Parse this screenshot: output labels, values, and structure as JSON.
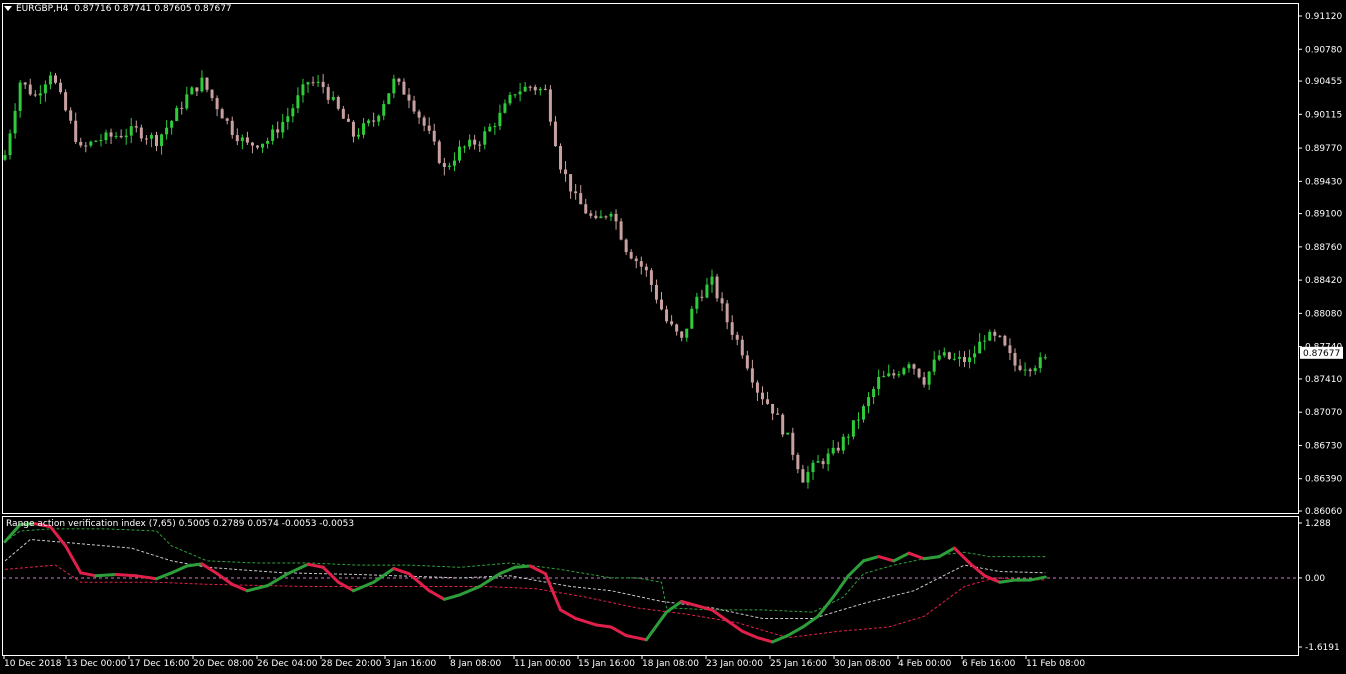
{
  "header": {
    "symbol": "EURGBP,H4",
    "ohlc": "0.87716 0.87741 0.87605 0.87677"
  },
  "indicator": {
    "title": "Range action verification index (7,65) 0.5005 0.2789 0.0574 -0.0053 -0.0053"
  },
  "colors": {
    "background": "#000000",
    "frame": "#ffffff",
    "bull_candle": "#2ecc3a",
    "bear_candle": "#c8a0a0",
    "line_up": "#2e9e3a",
    "line_down": "#e0204a",
    "zero_line": "#c878c8",
    "band_upper": "#2e9e3a",
    "band_lower": "#e0204a",
    "band_mid": "#c8c8c8"
  },
  "chart_data": [
    {
      "type": "candlestick",
      "symbol": "EURGBP",
      "timeframe": "H4",
      "current_price": "0.87677",
      "y_ticks": [
        "0.91120",
        "0.90780",
        "0.90455",
        "0.90115",
        "0.89770",
        "0.89430",
        "0.89100",
        "0.88760",
        "0.88420",
        "0.88080",
        "0.87740",
        "0.87410",
        "0.87070",
        "0.86730",
        "0.86390",
        "0.86060"
      ],
      "ylim": [
        0.8606,
        0.9112
      ],
      "x_ticks": [
        "10 Dec 2018",
        "13 Dec 00:00",
        "17 Dec 16:00",
        "20 Dec 08:00",
        "26 Dec 04:00",
        "28 Dec 20:00",
        "3 Jan 16:00",
        "8 Jan 08:00",
        "11 Jan 00:00",
        "15 Jan 16:00",
        "18 Jan 08:00",
        "23 Jan 00:00",
        "25 Jan 16:00",
        "30 Jan 08:00",
        "4 Feb 00:00",
        "6 Feb 16:00",
        "11 Feb 08:00"
      ],
      "close_path": [
        [
          0,
          0.897
        ],
        [
          3,
          0.9045
        ],
        [
          6,
          0.903
        ],
        [
          9,
          0.9055
        ],
        [
          12,
          0.9015
        ],
        [
          15,
          0.8975
        ],
        [
          18,
          0.8985
        ],
        [
          22,
          0.899
        ],
        [
          26,
          0.8995
        ],
        [
          30,
          0.8985
        ],
        [
          33,
          0.9005
        ],
        [
          36,
          0.903
        ],
        [
          39,
          0.9045
        ],
        [
          42,
          0.902
        ],
        [
          45,
          0.8995
        ],
        [
          48,
          0.898
        ],
        [
          52,
          0.8985
        ],
        [
          56,
          0.901
        ],
        [
          60,
          0.9045
        ],
        [
          63,
          0.904
        ],
        [
          66,
          0.9015
        ],
        [
          69,
          0.899
        ],
        [
          73,
          0.9005
        ],
        [
          77,
          0.9045
        ],
        [
          80,
          0.903
        ],
        [
          84,
          0.899
        ],
        [
          87,
          0.8955
        ],
        [
          90,
          0.8975
        ],
        [
          94,
          0.8985
        ],
        [
          98,
          0.901
        ],
        [
          101,
          0.9035
        ],
        [
          104,
          0.904
        ],
        [
          107,
          0.9035
        ],
        [
          110,
          0.896
        ],
        [
          113,
          0.8925
        ],
        [
          117,
          0.89
        ],
        [
          120,
          0.8915
        ],
        [
          123,
          0.8875
        ],
        [
          127,
          0.885
        ],
        [
          131,
          0.88
        ],
        [
          134,
          0.878
        ],
        [
          137,
          0.8825
        ],
        [
          140,
          0.884
        ],
        [
          143,
          0.88
        ],
        [
          146,
          0.877
        ],
        [
          149,
          0.873
        ],
        [
          152,
          0.871
        ],
        [
          155,
          0.868
        ],
        [
          158,
          0.864
        ],
        [
          161,
          0.8655
        ],
        [
          164,
          0.8665
        ],
        [
          167,
          0.8685
        ],
        [
          170,
          0.871
        ],
        [
          173,
          0.874
        ],
        [
          176,
          0.8745
        ],
        [
          179,
          0.876
        ],
        [
          182,
          0.874
        ],
        [
          185,
          0.8765
        ],
        [
          188,
          0.876
        ],
        [
          191,
          0.876
        ],
        [
          194,
          0.8785
        ],
        [
          197,
          0.878
        ],
        [
          200,
          0.8755
        ],
        [
          203,
          0.8755
        ],
        [
          206,
          0.876
        ]
      ]
    },
    {
      "type": "line",
      "title": "Range action verification index (7,65)",
      "values_in_title": [
        0.5005,
        0.2789,
        0.0574,
        -0.0053,
        -0.0053
      ],
      "y_ticks": [
        "1.288",
        "0.00",
        "-1.6191"
      ],
      "ylim": [
        -1.6191,
        1.288
      ],
      "main_line": [
        [
          0,
          0.85
        ],
        [
          3,
          1.25
        ],
        [
          6,
          1.27
        ],
        [
          9,
          1.2
        ],
        [
          12,
          0.75
        ],
        [
          15,
          0.12
        ],
        [
          18,
          0.05
        ],
        [
          22,
          0.08
        ],
        [
          26,
          0.05
        ],
        [
          30,
          -0.02
        ],
        [
          33,
          0.12
        ],
        [
          36,
          0.28
        ],
        [
          39,
          0.33
        ],
        [
          42,
          0.1
        ],
        [
          45,
          -0.15
        ],
        [
          48,
          -0.3
        ],
        [
          52,
          -0.18
        ],
        [
          56,
          0.1
        ],
        [
          60,
          0.32
        ],
        [
          63,
          0.25
        ],
        [
          66,
          -0.1
        ],
        [
          69,
          -0.3
        ],
        [
          73,
          -0.1
        ],
        [
          77,
          0.22
        ],
        [
          80,
          0.1
        ],
        [
          84,
          -0.3
        ],
        [
          87,
          -0.5
        ],
        [
          90,
          -0.4
        ],
        [
          94,
          -0.2
        ],
        [
          98,
          0.1
        ],
        [
          101,
          0.25
        ],
        [
          104,
          0.28
        ],
        [
          107,
          0.1
        ],
        [
          110,
          -0.75
        ],
        [
          113,
          -0.95
        ],
        [
          117,
          -1.1
        ],
        [
          120,
          -1.15
        ],
        [
          123,
          -1.35
        ],
        [
          127,
          -1.45
        ],
        [
          131,
          -0.8
        ],
        [
          134,
          -0.55
        ],
        [
          137,
          -0.65
        ],
        [
          140,
          -0.75
        ],
        [
          143,
          -1.0
        ],
        [
          146,
          -1.25
        ],
        [
          149,
          -1.4
        ],
        [
          152,
          -1.5
        ],
        [
          155,
          -1.35
        ],
        [
          158,
          -1.15
        ],
        [
          161,
          -0.9
        ],
        [
          164,
          -0.45
        ],
        [
          167,
          0.05
        ],
        [
          170,
          0.4
        ],
        [
          173,
          0.5
        ],
        [
          176,
          0.4
        ],
        [
          179,
          0.58
        ],
        [
          182,
          0.45
        ],
        [
          185,
          0.5
        ],
        [
          188,
          0.7
        ],
        [
          191,
          0.35
        ],
        [
          194,
          0.05
        ],
        [
          197,
          -0.1
        ],
        [
          200,
          -0.05
        ],
        [
          203,
          -0.05
        ],
        [
          206,
          0.02
        ]
      ],
      "upper_band": [
        [
          0,
          0.85
        ],
        [
          3,
          1.1
        ],
        [
          9,
          1.15
        ],
        [
          20,
          1.15
        ],
        [
          30,
          1.1
        ],
        [
          33,
          0.75
        ],
        [
          40,
          0.4
        ],
        [
          50,
          0.35
        ],
        [
          60,
          0.35
        ],
        [
          70,
          0.3
        ],
        [
          80,
          0.3
        ],
        [
          90,
          0.25
        ],
        [
          100,
          0.35
        ],
        [
          110,
          0.2
        ],
        [
          120,
          0.0
        ],
        [
          125,
          0.0
        ],
        [
          130,
          -0.1
        ],
        [
          131,
          -0.7
        ],
        [
          140,
          -0.75
        ],
        [
          150,
          -0.75
        ],
        [
          160,
          -0.8
        ],
        [
          166,
          -0.45
        ],
        [
          170,
          0.1
        ],
        [
          176,
          0.3
        ],
        [
          186,
          0.55
        ],
        [
          190,
          0.6
        ],
        [
          195,
          0.5
        ],
        [
          206,
          0.5
        ]
      ],
      "mid_band": [
        [
          0,
          0.4
        ],
        [
          5,
          0.9
        ],
        [
          15,
          0.8
        ],
        [
          25,
          0.7
        ],
        [
          33,
          0.4
        ],
        [
          40,
          0.25
        ],
        [
          55,
          0.12
        ],
        [
          70,
          0.08
        ],
        [
          90,
          0.0
        ],
        [
          100,
          0.05
        ],
        [
          112,
          -0.2
        ],
        [
          120,
          -0.3
        ],
        [
          130,
          -0.55
        ],
        [
          140,
          -0.7
        ],
        [
          150,
          -0.95
        ],
        [
          160,
          -0.95
        ],
        [
          170,
          -0.6
        ],
        [
          180,
          -0.3
        ],
        [
          190,
          0.3
        ],
        [
          197,
          0.15
        ],
        [
          206,
          0.12
        ]
      ],
      "lower_band": [
        [
          0,
          0.2
        ],
        [
          10,
          0.3
        ],
        [
          15,
          -0.1
        ],
        [
          30,
          -0.1
        ],
        [
          40,
          -0.15
        ],
        [
          60,
          -0.2
        ],
        [
          80,
          -0.2
        ],
        [
          95,
          -0.2
        ],
        [
          105,
          -0.25
        ],
        [
          115,
          -0.45
        ],
        [
          125,
          -0.7
        ],
        [
          135,
          -0.85
        ],
        [
          145,
          -1.05
        ],
        [
          155,
          -1.4
        ],
        [
          165,
          -1.25
        ],
        [
          175,
          -1.15
        ],
        [
          182,
          -0.9
        ],
        [
          190,
          -0.2
        ],
        [
          196,
          0.0
        ],
        [
          206,
          -0.05
        ]
      ]
    }
  ]
}
